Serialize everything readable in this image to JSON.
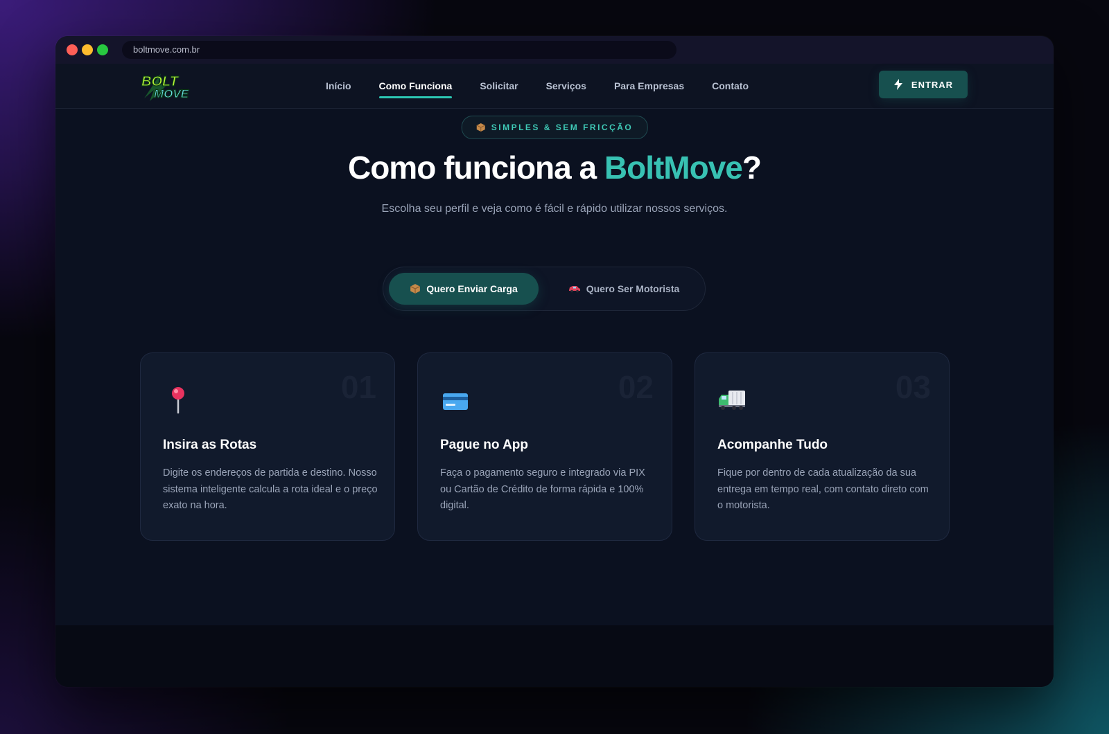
{
  "browser": {
    "url": "boltmove.com.br"
  },
  "brand": {
    "logo_line1": "BOLT",
    "logo_line2": "MOVE"
  },
  "nav": {
    "items": [
      {
        "label": "Início",
        "active": false
      },
      {
        "label": "Como Funciona",
        "active": true
      },
      {
        "label": "Solicitar",
        "active": false
      },
      {
        "label": "Serviços",
        "active": false
      },
      {
        "label": "Para Empresas",
        "active": false
      },
      {
        "label": "Contato",
        "active": false
      }
    ],
    "login_label": "ENTRAR"
  },
  "hero": {
    "badge": "SIMPLES & SEM FRICÇÃO",
    "badge_icon": "package-icon",
    "title_prefix": "Como funciona a ",
    "title_brand": "BoltMove",
    "title_suffix": "?",
    "subtitle": "Escolha seu perfil e veja como é fácil e rápido utilizar nossos serviços."
  },
  "toggle": {
    "options": [
      {
        "label": "Quero Enviar Carga",
        "icon": "package-icon",
        "active": true
      },
      {
        "label": "Quero Ser Motorista",
        "icon": "car-icon",
        "active": false
      }
    ]
  },
  "steps": [
    {
      "number": "01",
      "icon": "pin-icon",
      "title": "Insira as Rotas",
      "description": "Digite os endereços de partida e destino. Nosso sistema inteligente calcula a rota ideal e o preço exato na hora."
    },
    {
      "number": "02",
      "icon": "credit-card-icon",
      "title": "Pague no App",
      "description": "Faça o pagamento seguro e integrado via PIX ou Cartão de Crédito de forma rápida e 100% digital."
    },
    {
      "number": "03",
      "icon": "truck-icon",
      "title": "Acompanhe Tudo",
      "description": "Fique por dentro de cada atualização da sua entrega em tempo real, com contato direto com o motorista."
    }
  ],
  "colors": {
    "accent": "#38c2b3",
    "button": "#17504f",
    "background": "#0b1120"
  }
}
